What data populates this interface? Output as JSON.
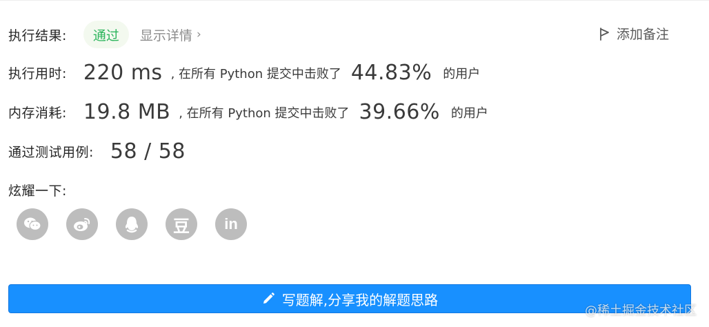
{
  "result": {
    "label": "执行结果:",
    "status": "通过",
    "details_link": "显示详情",
    "chevron": "›",
    "add_note": "添加备注"
  },
  "runtime": {
    "label": "执行用时:",
    "value": "220 ms",
    "middle_text": ", 在所有 Python 提交中击败了",
    "percent": "44.83%",
    "suffix": "的用户"
  },
  "memory": {
    "label": "内存消耗:",
    "value": "19.8 MB",
    "middle_text": ", 在所有 Python 提交中击败了",
    "percent": "39.66%",
    "suffix": "的用户"
  },
  "testcases": {
    "label": "通过测试用例:",
    "value": "58 / 58"
  },
  "share": {
    "label": "炫耀一下:",
    "icons": [
      "wechat-icon",
      "weibo-icon",
      "qq-icon",
      "douban-icon",
      "linkedin-icon"
    ],
    "douban_glyph": "豆",
    "linkedin_glyph": "in"
  },
  "write_solution": {
    "label": "写题解,分享我的解题思路"
  },
  "watermark": "@稀土掘金技术社区",
  "colors": {
    "accent": "#1890ff",
    "success": "#2db55d",
    "icon_gray": "#bdbdbd"
  }
}
